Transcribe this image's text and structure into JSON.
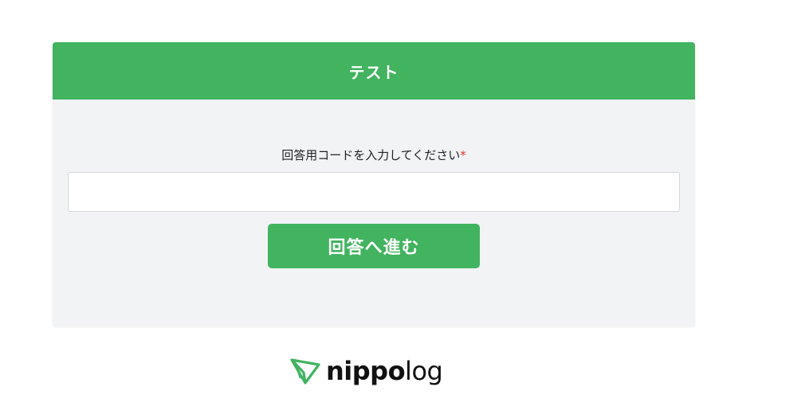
{
  "form": {
    "title": "テスト",
    "field_label": "回答用コードを入力してください",
    "required_mark": "*",
    "code_input_value": "",
    "submit_label": "回答へ進む"
  },
  "logo": {
    "text_bold": "nippo",
    "text_light": "log",
    "icon": "paper-plane-icon",
    "accent_color": "#42b35f"
  },
  "colors": {
    "header_bg": "#42b35f",
    "button_bg": "#42b35f",
    "card_bg": "#f2f3f5",
    "required": "#e0362c"
  }
}
